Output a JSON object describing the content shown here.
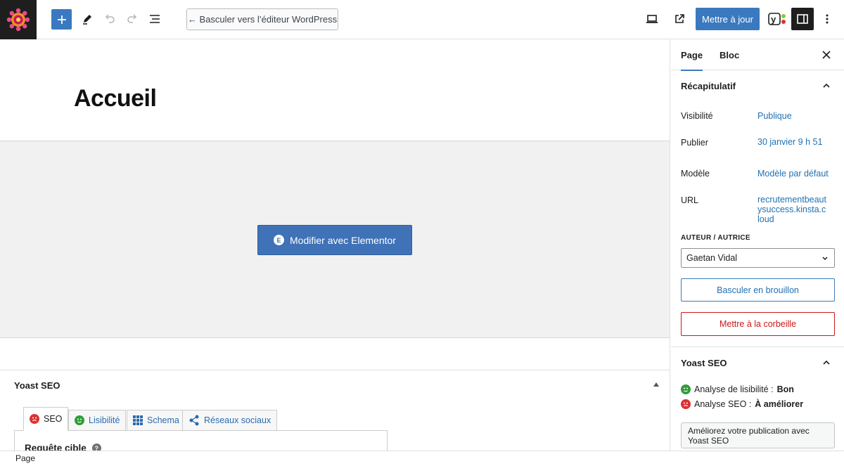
{
  "toolbar": {
    "switch_label": "← Basculer vers l’éditeur WordPress",
    "publish_label": "Mettre à jour",
    "accent_color": "#3a79bf"
  },
  "canvas": {
    "page_title": "Accueil",
    "elementor_button": "Modifier avec Elementor"
  },
  "yoast_panel": {
    "title": "Yoast SEO",
    "tabs": [
      {
        "label": "SEO",
        "icon": "sad-face-icon"
      },
      {
        "label": "Lisibilité",
        "icon": "smile-face-icon"
      },
      {
        "label": "Schema",
        "icon": "grid-icon"
      },
      {
        "label": "Réseaux sociaux",
        "icon": "share-icon"
      }
    ],
    "focus_keyphrase_label": "Requête cible"
  },
  "sidebar": {
    "tabs": [
      "Page",
      "Bloc"
    ],
    "summary": {
      "title": "Récapitulatif",
      "rows": [
        {
          "label": "Visibilité",
          "value": "Publique"
        },
        {
          "label": "Publier",
          "value": "30 janvier 9 h 51"
        },
        {
          "label": "Modèle",
          "value": "Modèle par défaut"
        },
        {
          "label": "URL",
          "value": "recrutementbeautysuccess.kinsta.cloud"
        }
      ],
      "author_label": "AUTEUR / AUTRICE",
      "author_value": "Gaetan Vidal",
      "draft_button": "Basculer en brouillon",
      "trash_button": "Mettre à la corbeille"
    },
    "yoast": {
      "title": "Yoast SEO",
      "readability_label": "Analyse de lisibilité :",
      "readability_value": "Bon",
      "seo_label": "Analyse SEO :",
      "seo_value": "À améliorer",
      "improve_button": "Améliorez votre publication avec Yoast SEO"
    }
  },
  "statusbar": {
    "breadcrumb": "Page"
  }
}
